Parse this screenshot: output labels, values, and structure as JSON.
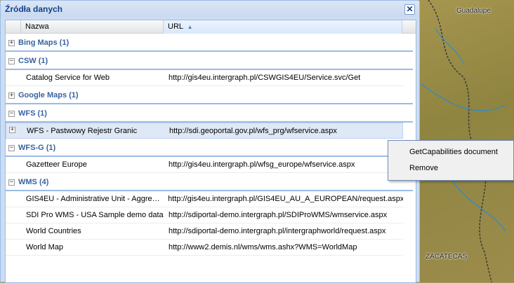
{
  "window": {
    "title": "Źródła danych",
    "close": "✕"
  },
  "columns": {
    "name": "Nazwa",
    "url": "URL",
    "sort_icon": "▲"
  },
  "groups": [
    {
      "title": "Bing Maps (1)",
      "expanded": false,
      "rows": []
    },
    {
      "title": "CSW (1)",
      "expanded": true,
      "rows": [
        {
          "name": "Catalog Service for Web",
          "url": "http://gis4eu.intergraph.pl/CSWGIS4EU/Service.svc/Get"
        }
      ]
    },
    {
      "title": "Google Maps (1)",
      "expanded": false,
      "rows": []
    },
    {
      "title": "WFS (1)",
      "expanded": true,
      "rows": [
        {
          "name": "WFS - Pastwowy Rejestr Granic",
          "url": "http://sdi.geoportal.gov.pl/wfs_prg/wfservice.aspx"
        }
      ]
    },
    {
      "title": "WFS-G (1)",
      "expanded": true,
      "rows": [
        {
          "name": "Gazetteer Europe",
          "url": "http://gis4eu.intergraph.pl/wfsg_europe/wfservice.aspx"
        }
      ]
    },
    {
      "title": "WMS (4)",
      "expanded": true,
      "rows": [
        {
          "name": "GIS4EU - Administrative Unit - Aggrega...",
          "url": "http://gis4eu.intergraph.pl/GIS4EU_AU_A_EUROPEAN/request.aspx"
        },
        {
          "name": "SDI Pro WMS - USA Sample demo data",
          "url": "http://sdiportal-demo.intergraph.pl/SDIProWMS/wmservice.aspx"
        },
        {
          "name": "World Countries",
          "url": "http://sdiportal-demo.intergraph.pl/intergraphworld/request.aspx"
        },
        {
          "name": "World Map",
          "url": "http://www2.demis.nl/wms/wms.ashx?WMS=WorldMap"
        }
      ]
    }
  ],
  "context_menu": {
    "items": [
      "GetCapabilities document",
      "Remove"
    ]
  },
  "map_labels": {
    "guadalupe": "Guadalupe",
    "zacatecas": "ZACATECAS"
  },
  "icons": {
    "collapsed": "⊞",
    "expanded": "⊟"
  }
}
